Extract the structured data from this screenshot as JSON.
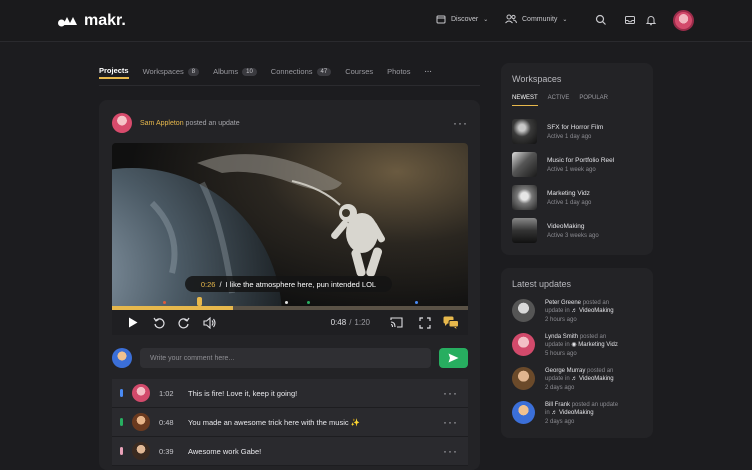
{
  "app": {
    "name": "makr."
  },
  "topnav": {
    "discover": "Discover",
    "community": "Community"
  },
  "profile_tabs": [
    {
      "label": "Projects",
      "count": null
    },
    {
      "label": "Workspaces",
      "count": "8"
    },
    {
      "label": "Albums",
      "count": "10"
    },
    {
      "label": "Connections",
      "count": "47"
    },
    {
      "label": "Courses",
      "count": null
    },
    {
      "label": "Photos",
      "count": null
    }
  ],
  "post": {
    "author": "Sam Appleton",
    "action": "posted an update"
  },
  "video": {
    "caption_time": "0:26",
    "caption_sep": "/",
    "caption_text": "I like the atmosphere here, pun intended LOL",
    "current_time": "0:48",
    "time_sep": "/",
    "duration": "1:20",
    "progress": 0.34
  },
  "comment": {
    "placeholder": "Write your comment here..."
  },
  "comments": [
    {
      "time": "1:02",
      "text": "This is fire! Love it, keep it going!",
      "mark": "#4a8bf5"
    },
    {
      "time": "0:48",
      "text": "You made an awesome trick here with the music ✨",
      "mark": "#27ae60"
    },
    {
      "time": "0:39",
      "text": "Awesome work Gabe!",
      "mark": "#e8a1b8"
    }
  ],
  "workspaces_panel": {
    "title": "Workspaces",
    "tabs": [
      "NEWEST",
      "ACTIVE",
      "POPULAR"
    ],
    "items": [
      {
        "title": "SFX for Horror Film",
        "sub": "Active 1 day ago"
      },
      {
        "title": "Music for Portfolio Reel",
        "sub": "Active 1 week ago"
      },
      {
        "title": "Marketing Vidz",
        "sub": "Active 1 day ago"
      },
      {
        "title": "VideoMaking",
        "sub": "Active 3 weeks ago"
      }
    ]
  },
  "updates_panel": {
    "title": "Latest updates",
    "items": [
      {
        "name": "Peter Greene",
        "action": "posted an",
        "line2": "update in",
        "workspace": "VideoMaking",
        "time": "2 hours ago"
      },
      {
        "name": "Lynda Smith",
        "action": "posted an",
        "line2": "update in",
        "workspace": "Marketing Vidz",
        "time": "5 hours ago"
      },
      {
        "name": "George Murray",
        "action": "posted an",
        "line2": "update in",
        "workspace": "VideoMaking",
        "time": "2 days ago"
      },
      {
        "name": "Bill Frank",
        "action": "posted an update",
        "line2": "in",
        "workspace": "VideoMaking",
        "time": "2 days ago"
      }
    ]
  },
  "colors": {
    "accent": "#e7b84c",
    "send": "#27ae60",
    "bg": "#1c1c1f"
  }
}
